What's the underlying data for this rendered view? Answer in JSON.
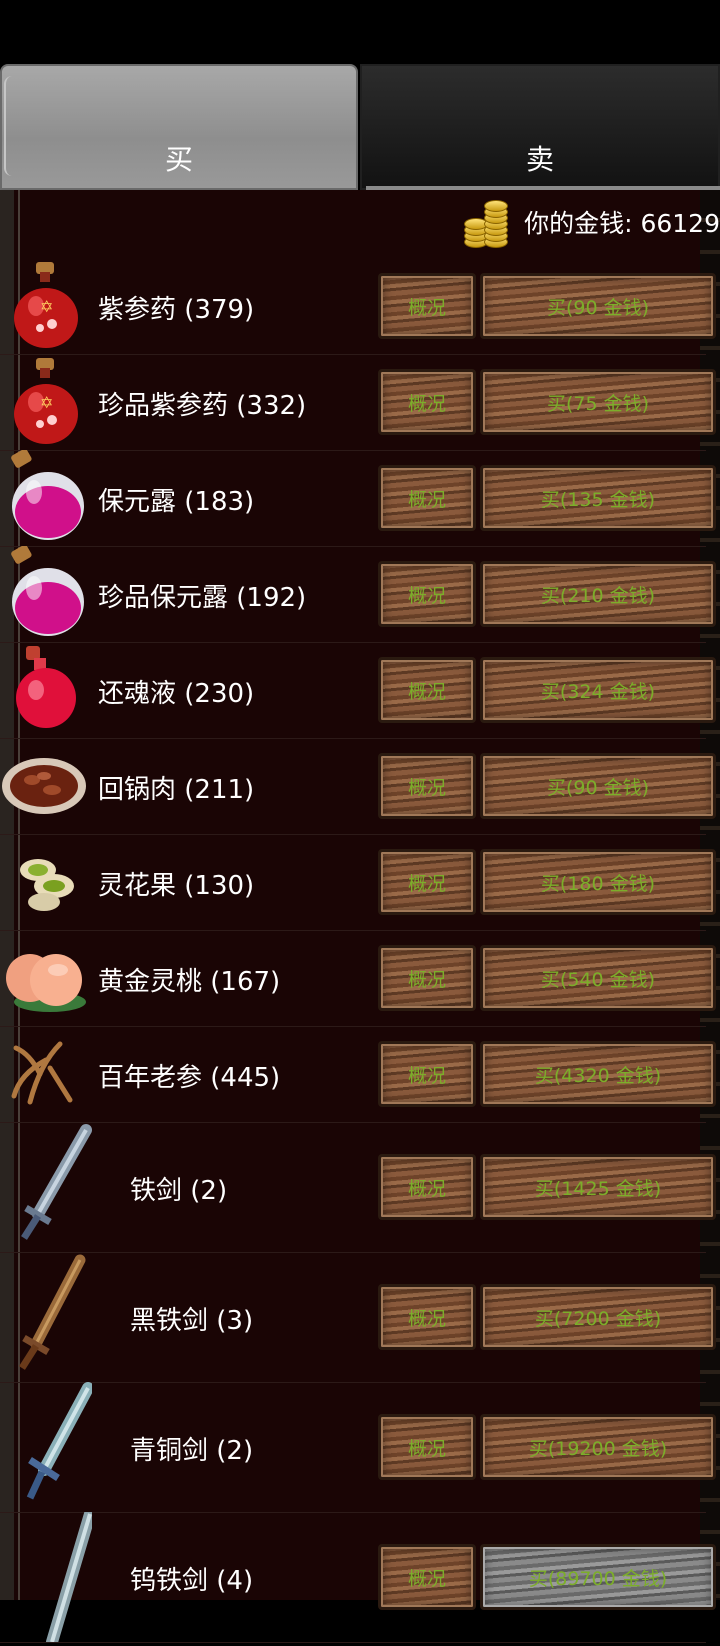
{
  "tabs": {
    "buy": "买",
    "sell": "卖"
  },
  "gold": {
    "label": "你的金钱: 66129"
  },
  "items": [
    {
      "name": "紫参药 (379)",
      "info": "概况",
      "buy": "买(90 金钱)",
      "icon": "red-potion-icon"
    },
    {
      "name": "珍品紫参药 (332)",
      "info": "概况",
      "buy": "买(75 金钱)",
      "icon": "red-potion-icon"
    },
    {
      "name": "保元露 (183)",
      "info": "概况",
      "buy": "买(135 金钱)",
      "icon": "pink-potion-icon"
    },
    {
      "name": "珍品保元露 (192)",
      "info": "概况",
      "buy": "买(210 金钱)",
      "icon": "pink-potion-icon"
    },
    {
      "name": "还魂液 (230)",
      "info": "概况",
      "buy": "买(324 金钱)",
      "icon": "crimson-potion-icon"
    },
    {
      "name": "回锅肉 (211)",
      "info": "概况",
      "buy": "买(90 金钱)",
      "icon": "meat-dish-icon"
    },
    {
      "name": "灵花果 (130)",
      "info": "概况",
      "buy": "买(180 金钱)",
      "icon": "pistachio-icon"
    },
    {
      "name": "黄金灵桃 (167)",
      "info": "概况",
      "buy": "买(540 金钱)",
      "icon": "peach-icon"
    },
    {
      "name": "百年老参 (445)",
      "info": "概况",
      "buy": "买(4320 金钱)",
      "icon": "ginseng-icon"
    },
    {
      "name": "铁剑 (2)",
      "info": "概况",
      "buy": "买(1425 金钱)",
      "icon": "iron-sword-icon"
    },
    {
      "name": "黑铁剑 (3)",
      "info": "概况",
      "buy": "买(7200 金钱)",
      "icon": "wooden-sword-icon"
    },
    {
      "name": "青铜剑 (2)",
      "info": "概况",
      "buy": "买(19200 金钱)",
      "icon": "bronze-sword-icon"
    },
    {
      "name": "钨铁剑 (4)",
      "info": "概况",
      "buy": "买(89700 金钱)",
      "icon": "steel-sword-icon"
    }
  ],
  "colors": {
    "price_text": "#7cae2a",
    "panel_bg": "#1a0505",
    "tab_active": "#9e9e9e"
  }
}
